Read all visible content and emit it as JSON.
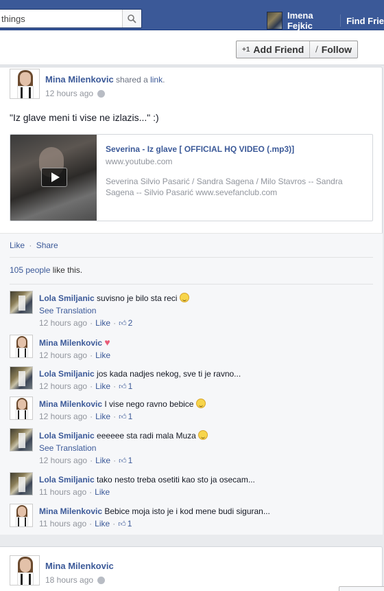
{
  "topbar": {
    "search_value": "things",
    "user_name": "Imena Fejkic",
    "find_friends": "Find Frie"
  },
  "profile_actions": {
    "add_friend": "Add Friend",
    "follow": "Follow"
  },
  "post": {
    "author": "Mina Milenkovic",
    "shared_prefix": "shared a",
    "shared_link": "link",
    "shared_suffix": ".",
    "time": "12 hours ago",
    "text": "\"Iz glave meni ti vise ne izlazis...\" :)",
    "share": {
      "title": "Severina - Iz glave [ OFFICIAL HQ VIDEO (.mp3)]",
      "domain": "www.youtube.com",
      "description": "Severina Silvio Pasarić / Sandra Sagena / Milo Stavros -- Sandra Sagena -- Silvio Pasarić www.sevefanclub.com"
    },
    "actions": {
      "like": "Like",
      "share": "Share"
    },
    "likes_count": "105 people",
    "likes_suffix": "like this.",
    "comments": [
      {
        "author": "Lola Smiljanic",
        "text": "suvisno je bilo sta reci",
        "emoji": "smile",
        "translation": "See Translation",
        "time": "12 hours ago",
        "like": "Like",
        "likes": "2",
        "avatar": "lola"
      },
      {
        "author": "Mina Milenkovic",
        "text": "",
        "emoji": "heart",
        "translation": "",
        "time": "12 hours ago",
        "like": "Like",
        "likes": "",
        "avatar": "mina"
      },
      {
        "author": "Lola Smiljanic",
        "text": "jos kada nadjes nekog, sve ti je ravno...",
        "emoji": "",
        "translation": "",
        "time": "12 hours ago",
        "like": "Like",
        "likes": "1",
        "avatar": "lola"
      },
      {
        "author": "Mina Milenkovic",
        "text": "I vise nego ravno bebice",
        "emoji": "smile",
        "translation": "",
        "time": "12 hours ago",
        "like": "Like",
        "likes": "1",
        "avatar": "mina"
      },
      {
        "author": "Lola Smiljanic",
        "text": "eeeeee sta radi mala Muza",
        "emoji": "smile",
        "translation": "See Translation",
        "time": "12 hours ago",
        "like": "Like",
        "likes": "1",
        "avatar": "lola"
      },
      {
        "author": "Lola Smiljanic",
        "text": "tako nesto treba osetiti kao sto ja osecam...",
        "emoji": "",
        "translation": "",
        "time": "11 hours ago",
        "like": "Like",
        "likes": "",
        "avatar": "lola"
      },
      {
        "author": "Mina Milenkovic",
        "text": "Bebice moja isto je i kod mene budi siguran...",
        "emoji": "",
        "translation": "",
        "time": "11 hours ago",
        "like": "Like",
        "likes": "1",
        "avatar": "mina"
      }
    ]
  },
  "post2": {
    "author": "Mina Milenkovic",
    "time": "18 hours ago"
  },
  "colors": {
    "brand": "#3b5998",
    "link": "#3b5998",
    "meta": "#90949c"
  }
}
